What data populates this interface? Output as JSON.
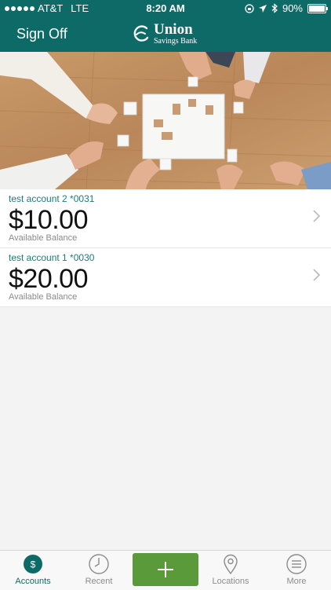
{
  "status_bar": {
    "carrier": "AT&T",
    "network": "LTE",
    "time": "8:20 AM",
    "battery": "90%",
    "battery_level": 0.9
  },
  "nav": {
    "sign_off_label": "Sign Off",
    "logo_main": "Union",
    "logo_sub": "Savings Bank"
  },
  "accounts": [
    {
      "name": "test account 2 *0031",
      "balance": "$10.00",
      "label": "Available Balance"
    },
    {
      "name": "test account 1 *0030",
      "balance": "$20.00",
      "label": "Available Balance"
    }
  ],
  "tabbar": {
    "accounts": "Accounts",
    "recent": "Recent",
    "locations": "Locations",
    "more": "More",
    "accounts_icon_glyph": "$"
  },
  "colors": {
    "brand": "#0e6a66",
    "add_button": "#5a9a3b",
    "account_name": "#1a7c77"
  }
}
